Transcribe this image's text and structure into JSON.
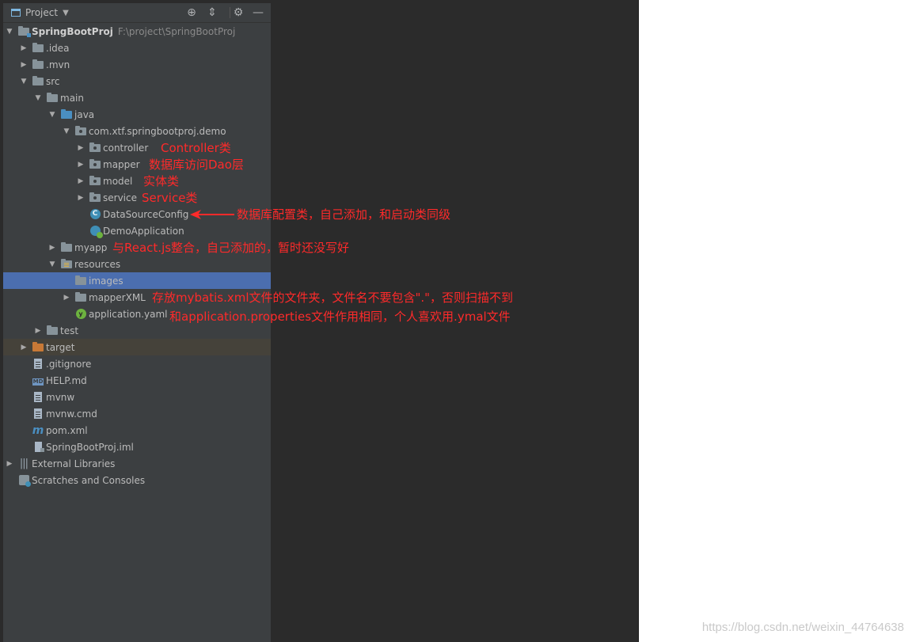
{
  "header": {
    "view_label": "Project",
    "icons": [
      "locate-icon",
      "collapse-all-icon",
      "gear-icon",
      "hide-icon"
    ]
  },
  "tree": [
    {
      "key": "root",
      "label": "SpringBootProj",
      "path": "F:\\project\\SpringBootProj",
      "icon": "module-folder-icon"
    },
    {
      "key": "idea",
      "label": ".idea",
      "icon": "folder-icon"
    },
    {
      "key": "mvn",
      "label": ".mvn",
      "icon": "folder-icon"
    },
    {
      "key": "src",
      "label": "src",
      "icon": "folder-icon"
    },
    {
      "key": "main",
      "label": "main",
      "icon": "folder-icon"
    },
    {
      "key": "java",
      "label": "java",
      "icon": "source-root-icon"
    },
    {
      "key": "pkg",
      "label": "com.xtf.springbootproj.demo",
      "icon": "package-icon"
    },
    {
      "key": "controller",
      "label": "controller",
      "icon": "package-icon"
    },
    {
      "key": "mapper",
      "label": "mapper",
      "icon": "package-icon"
    },
    {
      "key": "model",
      "label": "model",
      "icon": "package-icon"
    },
    {
      "key": "service",
      "label": "service",
      "icon": "package-icon"
    },
    {
      "key": "dsconfig",
      "label": "DataSourceConfig",
      "icon": "class-icon"
    },
    {
      "key": "demoapp",
      "label": "DemoApplication",
      "icon": "spring-app-icon"
    },
    {
      "key": "myapp",
      "label": "myapp",
      "icon": "folder-icon"
    },
    {
      "key": "resources",
      "label": "resources",
      "icon": "resources-icon"
    },
    {
      "key": "images",
      "label": "images",
      "icon": "folder-icon"
    },
    {
      "key": "mapperxml",
      "label": "mapperXML",
      "icon": "folder-icon"
    },
    {
      "key": "appyaml",
      "label": "application.yaml",
      "icon": "yaml-icon"
    },
    {
      "key": "test",
      "label": "test",
      "icon": "folder-icon"
    },
    {
      "key": "target",
      "label": "target",
      "icon": "excluded-folder-icon"
    },
    {
      "key": "gitignore",
      "label": ".gitignore",
      "icon": "file-icon"
    },
    {
      "key": "helpmd",
      "label": "HELP.md",
      "icon": "markdown-icon"
    },
    {
      "key": "mvnw",
      "label": "mvnw",
      "icon": "file-icon"
    },
    {
      "key": "mvnwcmd",
      "label": "mvnw.cmd",
      "icon": "file-icon"
    },
    {
      "key": "pom",
      "label": "pom.xml",
      "icon": "maven-icon"
    },
    {
      "key": "iml",
      "label": "SpringBootProj.iml",
      "icon": "iml-icon"
    },
    {
      "key": "extlibs",
      "label": "External Libraries",
      "icon": "libraries-icon"
    },
    {
      "key": "scratches",
      "label": "Scratches and Consoles",
      "icon": "scratches-icon"
    }
  ],
  "annotations": {
    "controller": "Controller类",
    "mapper": "数据库访问Dao层",
    "model": "实体类",
    "service": "Service类",
    "dsconfig": "数据库配置类，自己添加，和启动类同级",
    "myapp": "与React.js整合，自己添加的，暂时还没写好",
    "mapperxml": "存放mybatis.xml文件的文件夹，文件名不要包含\".\"，否则扫描不到",
    "appyaml": "和application.properties文件作用相同，个人喜欢用.ymal文件"
  },
  "colors": {
    "annotation": "#ff2a2a",
    "selection": "#4b6eaf",
    "panel_bg": "#3c3f41"
  },
  "watermark": "https://blog.csdn.net/weixin_44764638"
}
